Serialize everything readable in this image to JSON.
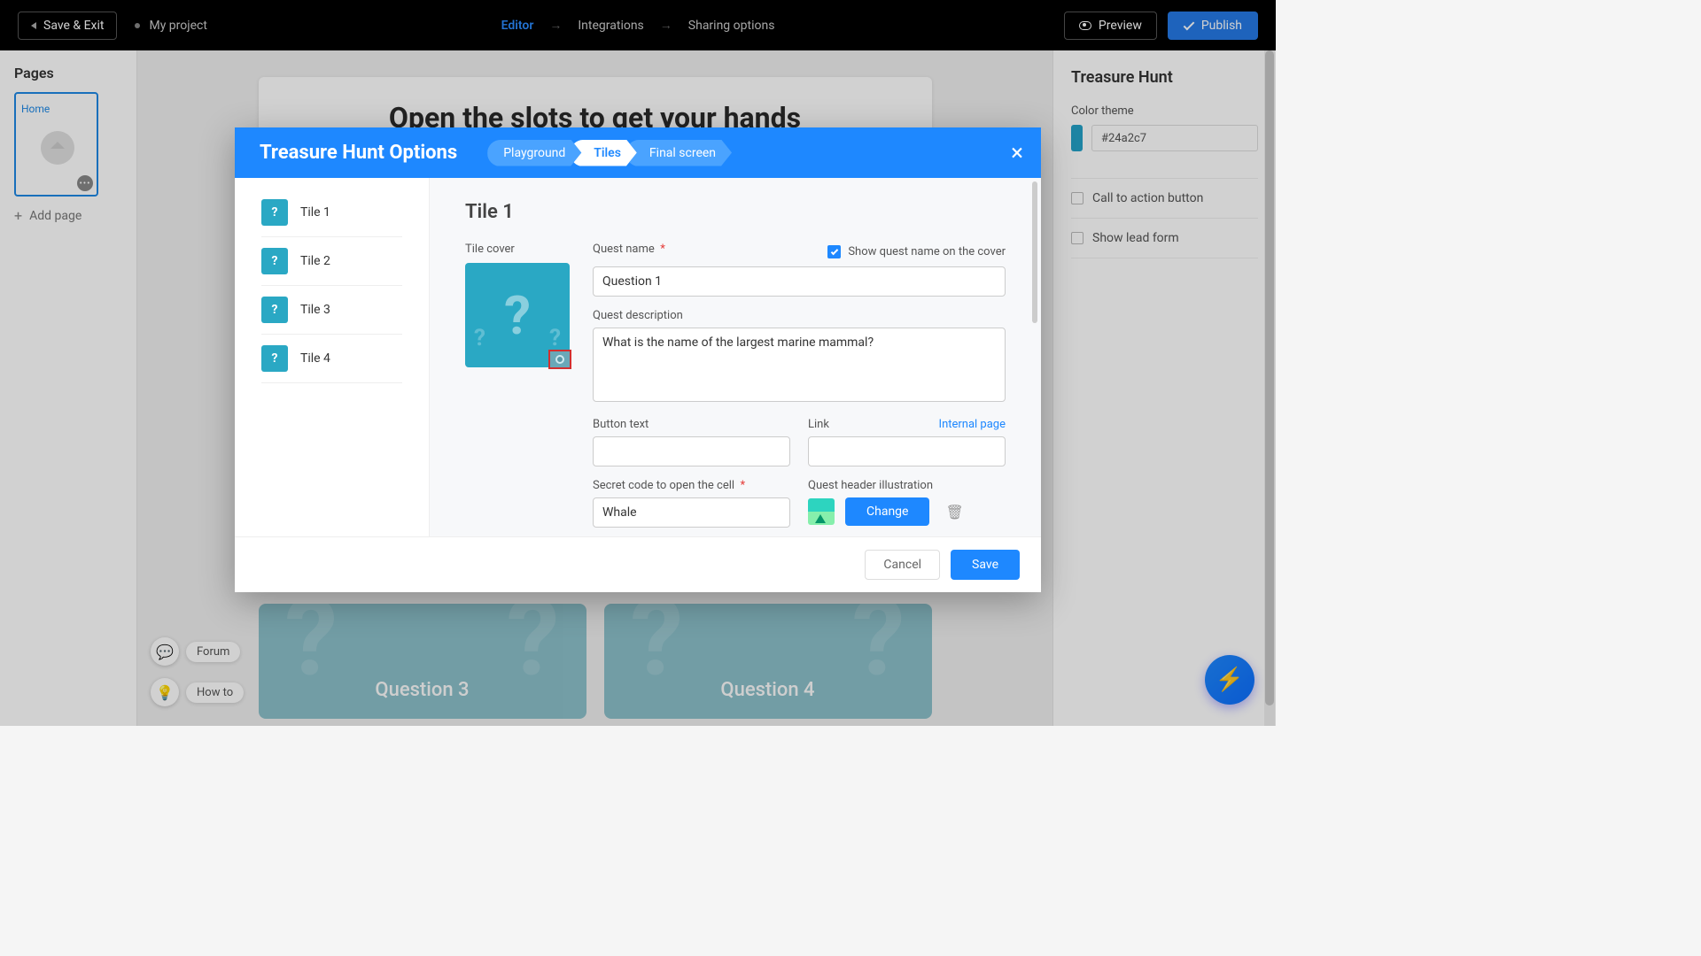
{
  "topbar": {
    "saveExit": "Save & Exit",
    "projectName": "My project",
    "nav": {
      "editor": "Editor",
      "integrations": "Integrations",
      "sharing": "Sharing options"
    },
    "preview": "Preview",
    "publish": "Publish"
  },
  "leftSidebar": {
    "title": "Pages",
    "pageLabel": "Home",
    "addPage": "Add page"
  },
  "canvas": {
    "heading": "Open the slots to get your hands",
    "tiles": [
      "Question 3",
      "Question 4"
    ]
  },
  "rightSidebar": {
    "title": "Treasure Hunt",
    "colorThemeLabel": "Color theme",
    "colorValue": "#24a2c7",
    "ctaLabel": "Call to action button",
    "leadFormLabel": "Show lead form"
  },
  "pills": {
    "forum": "Forum",
    "howto": "How to"
  },
  "modal": {
    "title": "Treasure Hunt Options",
    "steps": [
      "Playground",
      "Tiles",
      "Final screen"
    ],
    "tileList": [
      "Tile 1",
      "Tile 2",
      "Tile 3",
      "Tile 4"
    ],
    "form": {
      "heading": "Tile 1",
      "coverLabel": "Tile cover",
      "questNameLabel": "Quest name",
      "showNameLabel": "Show quest name on the cover",
      "questNameValue": "Question 1",
      "questDescLabel": "Quest description",
      "questDescValue": "What is the name of the largest marine mammal?",
      "buttonTextLabel": "Button text",
      "buttonTextValue": "",
      "linkLabel": "Link",
      "internalPage": "Internal page",
      "linkValue": "",
      "secretLabel": "Secret code to open the cell",
      "secretValue": "Whale",
      "illusLabel": "Quest header illustration",
      "changeBtn": "Change"
    },
    "footer": {
      "cancel": "Cancel",
      "save": "Save"
    }
  }
}
